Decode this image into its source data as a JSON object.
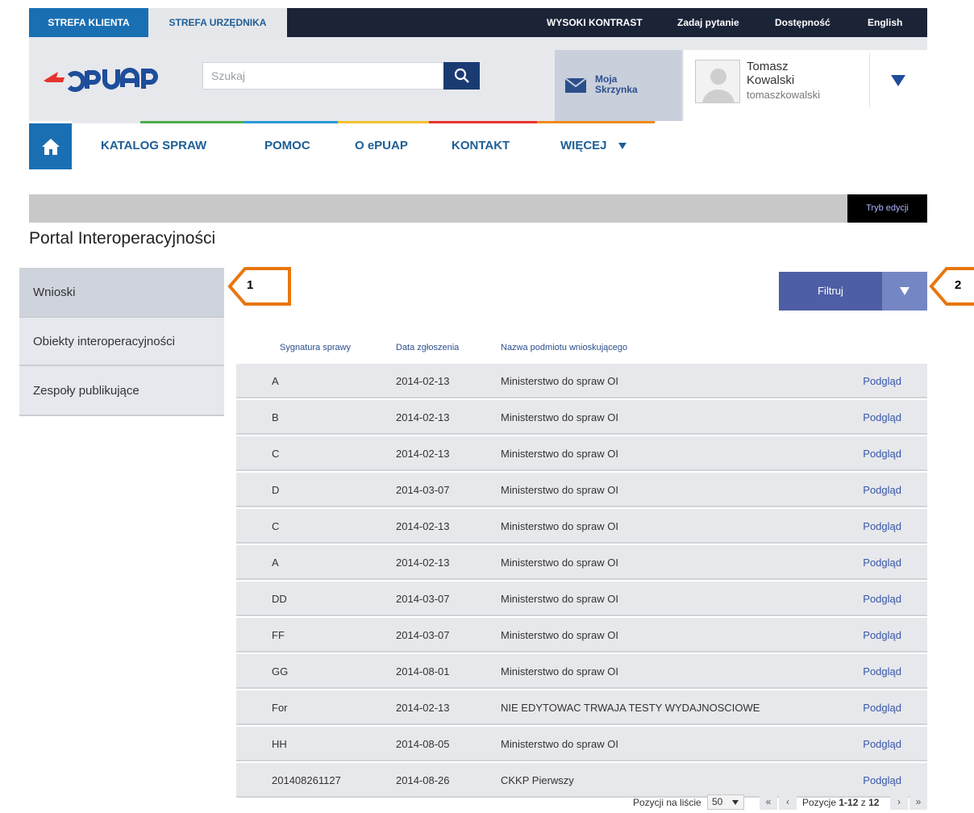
{
  "top_bar": {
    "zone_client": "STREFA KLIENTA",
    "zone_official": "STREFA URZĘDNIKA",
    "links": [
      "WYSOKI KONTRAST",
      "Zadaj pytanie",
      "Dostępność",
      "English"
    ]
  },
  "header": {
    "search_placeholder": "Szukaj",
    "mailbox_label": "Moja Skrzynka",
    "user_first_name": "Tomasz",
    "user_last_name": "Kowalski",
    "user_login": "tomaszkowalski"
  },
  "nav": {
    "items": [
      "KATALOG SPRAW",
      "POMOC",
      "O ePUAP",
      "KONTAKT",
      "WIĘCEJ"
    ]
  },
  "edit_mode_label": "Tryb edycji",
  "page_title": "Portal Interoperacyjności",
  "sidebar": {
    "items": [
      "Wnioski",
      "Obiekty interoperacyjności",
      "Zespoły publikujące"
    ]
  },
  "callouts": [
    "1",
    "2"
  ],
  "filter": {
    "label": "Filtruj"
  },
  "table": {
    "headers": [
      "Sygnatura sprawy",
      "Data zgłoszenia",
      "Nazwa podmiotu wnioskującego"
    ],
    "rows": [
      {
        "sig": "A",
        "date": "2014-02-13",
        "name": "Ministerstwo do spraw OI",
        "action": "Podgląd"
      },
      {
        "sig": "B",
        "date": "2014-02-13",
        "name": "Ministerstwo do spraw OI",
        "action": "Podgląd"
      },
      {
        "sig": "C",
        "date": "2014-02-13",
        "name": "Ministerstwo do spraw OI",
        "action": "Podgląd"
      },
      {
        "sig": "D",
        "date": "2014-03-07",
        "name": "Ministerstwo do spraw OI",
        "action": "Podgląd"
      },
      {
        "sig": "C",
        "date": "2014-02-13",
        "name": "Ministerstwo do spraw OI",
        "action": "Podgląd"
      },
      {
        "sig": "A",
        "date": "2014-02-13",
        "name": "Ministerstwo do spraw OI",
        "action": "Podgląd"
      },
      {
        "sig": "DD",
        "date": "2014-03-07",
        "name": "Ministerstwo do spraw OI",
        "action": "Podgląd"
      },
      {
        "sig": "FF",
        "date": "2014-03-07",
        "name": "Ministerstwo do spraw OI",
        "action": "Podgląd"
      },
      {
        "sig": "GG",
        "date": "2014-08-01",
        "name": "Ministerstwo do spraw OI",
        "action": "Podgląd"
      },
      {
        "sig": "For",
        "date": "2014-02-13",
        "name": "NIE EDYTOWAC TRWAJA TESTY WYDAJNOSCIOWE",
        "action": "Podgląd"
      },
      {
        "sig": "HH",
        "date": "2014-08-05",
        "name": "Ministerstwo do spraw OI",
        "action": "Podgląd"
      },
      {
        "sig": "201408261127",
        "date": "2014-08-26",
        "name": "CKKP Pierwszy",
        "action": "Podgląd"
      }
    ]
  },
  "pagination": {
    "per_page_label": "Pozycji na liście",
    "per_page_value": "50",
    "positions_label": "Pozycje",
    "range": "1-12",
    "of_label": "z",
    "total": "12"
  },
  "colors": {
    "brand_blue": "#1a6fb3",
    "dark_navy": "#1b2437",
    "logo_red": "#e8322d",
    "logo_blue": "#1f4d9b",
    "filter": "#4e5ea5",
    "callout_orange": "#e8760f"
  }
}
